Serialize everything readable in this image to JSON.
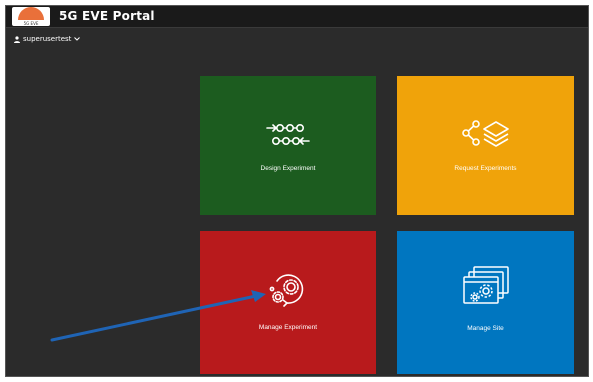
{
  "header": {
    "logo_text": "5G EVE",
    "title": "5G EVE Portal"
  },
  "user_menu": {
    "username": "superusertest",
    "icon": "user-icon",
    "chevron": "chevron-down-icon"
  },
  "tiles": [
    {
      "label": "Design Experiment",
      "icon": "workflow-icon",
      "color": "#1c5c1f"
    },
    {
      "label": "Request Experiments",
      "icon": "share-layers-icon",
      "color": "#f0a30a"
    },
    {
      "label": "Manage Experiment",
      "icon": "gears-cycle-icon",
      "color": "#b81a1c"
    },
    {
      "label": "Manage Site",
      "icon": "windows-gear-icon",
      "color": "#0076c0"
    }
  ],
  "colors": {
    "background": "#2b2b2b",
    "topbar": "#1a1a1a",
    "annotation_arrow": "#1f64b5"
  }
}
